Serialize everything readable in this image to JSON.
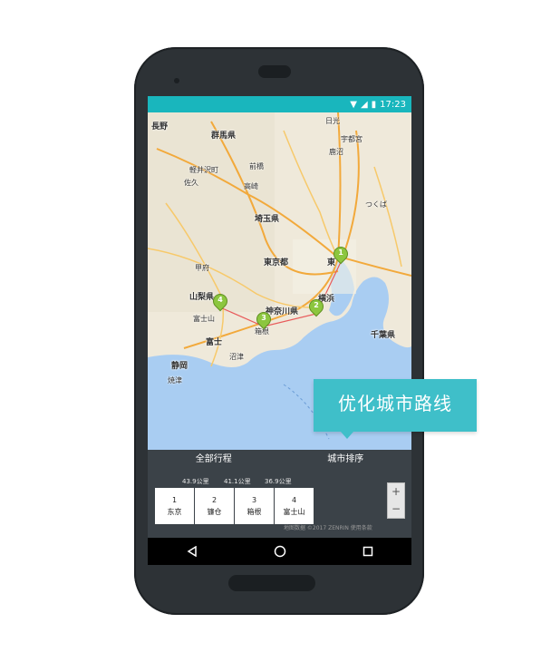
{
  "status_bar": {
    "time": "17:23"
  },
  "map": {
    "labels": {
      "nagano": "長野",
      "gunma": "群馬県",
      "nikko": "日光",
      "utsunomiya": "宇都宮",
      "kanuma": "鹿沼",
      "karuizawa": "軽井沢町",
      "saku": "佐久",
      "maebashi": "前橋",
      "takasaki": "高崎",
      "tsukuba": "つくば",
      "saitama": "埼玉県",
      "kofu": "甲府",
      "tokyo_to": "東京都",
      "tokyo_city": "東",
      "yamanashi": "山梨県",
      "kanagawa": "神奈川県",
      "yokohama": "横浜",
      "fujisan": "富士山",
      "fuji": "富士",
      "numazu": "沼津",
      "shizuoka": "静岡",
      "yaizu": "焼津",
      "chiba": "千葉県",
      "hakone": "箱根"
    },
    "pins": [
      {
        "num": "1"
      },
      {
        "num": "2"
      },
      {
        "num": "3"
      },
      {
        "num": "4"
      }
    ]
  },
  "panel": {
    "tabs": [
      "全部行程",
      "城市排序"
    ],
    "distances": [
      "43.9公里",
      "41.1公里",
      "36.9公里"
    ],
    "cards": [
      {
        "num": "1",
        "name": "东京"
      },
      {
        "num": "2",
        "name": "镰仓"
      },
      {
        "num": "3",
        "name": "箱根"
      },
      {
        "num": "4",
        "name": "富士山"
      }
    ],
    "zoom_in": "+",
    "zoom_out": "−",
    "copyright": "地图数据 ©2017 ZENRIN  使用条款"
  },
  "callout": {
    "text": "优化城市路线"
  }
}
